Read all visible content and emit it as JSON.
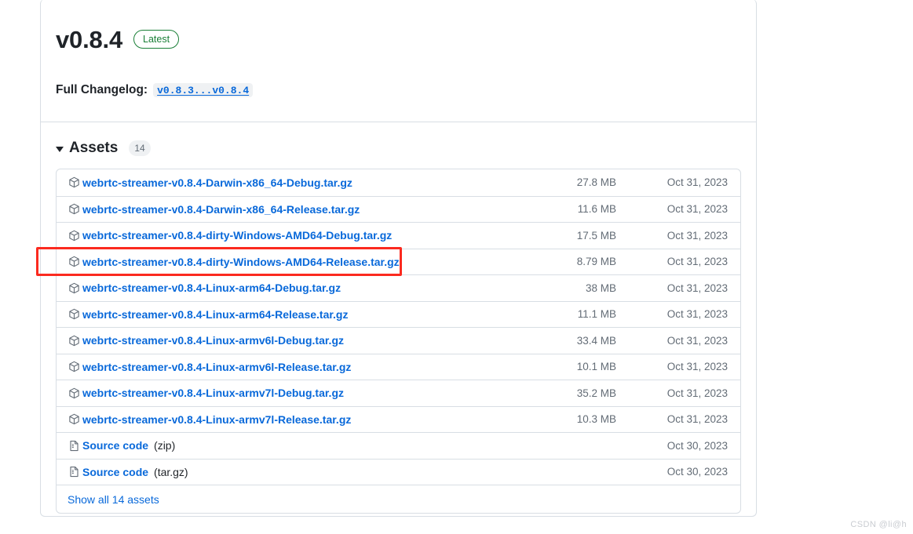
{
  "release": {
    "version_title": "v0.8.4",
    "latest_badge": "Latest",
    "changelog_label": "Full Changelog:",
    "changelog_link": "v0.8.3...v0.8.4"
  },
  "assets": {
    "section_title": "Assets",
    "count": "14",
    "disclosure_icon": "triangle-down-icon",
    "show_all_label": "Show all 14 assets",
    "rows": [
      {
        "icon": "package-icon",
        "name": "webrtc-streamer-v0.8.4-Darwin-x86_64-Debug.tar.gz",
        "suffix": "",
        "size": "27.8 MB",
        "date": "Oct 31, 2023"
      },
      {
        "icon": "package-icon",
        "name": "webrtc-streamer-v0.8.4-Darwin-x86_64-Release.tar.gz",
        "suffix": "",
        "size": "11.6 MB",
        "date": "Oct 31, 2023"
      },
      {
        "icon": "package-icon",
        "name": "webrtc-streamer-v0.8.4-dirty-Windows-AMD64-Debug.tar.gz",
        "suffix": "",
        "size": "17.5 MB",
        "date": "Oct 31, 2023"
      },
      {
        "icon": "package-icon",
        "name": "webrtc-streamer-v0.8.4-dirty-Windows-AMD64-Release.tar.gz",
        "suffix": "",
        "size": "8.79 MB",
        "date": "Oct 31, 2023"
      },
      {
        "icon": "package-icon",
        "name": "webrtc-streamer-v0.8.4-Linux-arm64-Debug.tar.gz",
        "suffix": "",
        "size": "38 MB",
        "date": "Oct 31, 2023"
      },
      {
        "icon": "package-icon",
        "name": "webrtc-streamer-v0.8.4-Linux-arm64-Release.tar.gz",
        "suffix": "",
        "size": "11.1 MB",
        "date": "Oct 31, 2023"
      },
      {
        "icon": "package-icon",
        "name": "webrtc-streamer-v0.8.4-Linux-armv6l-Debug.tar.gz",
        "suffix": "",
        "size": "33.4 MB",
        "date": "Oct 31, 2023"
      },
      {
        "icon": "package-icon",
        "name": "webrtc-streamer-v0.8.4-Linux-armv6l-Release.tar.gz",
        "suffix": "",
        "size": "10.1 MB",
        "date": "Oct 31, 2023"
      },
      {
        "icon": "package-icon",
        "name": "webrtc-streamer-v0.8.4-Linux-armv7l-Debug.tar.gz",
        "suffix": "",
        "size": "35.2 MB",
        "date": "Oct 31, 2023"
      },
      {
        "icon": "package-icon",
        "name": "webrtc-streamer-v0.8.4-Linux-armv7l-Release.tar.gz",
        "suffix": "",
        "size": "10.3 MB",
        "date": "Oct 31, 2023"
      },
      {
        "icon": "file-code-icon",
        "name": "Source code",
        "suffix": "(zip)",
        "size": "",
        "date": "Oct 30, 2023"
      },
      {
        "icon": "file-code-icon",
        "name": "Source code",
        "suffix": "(tar.gz)",
        "size": "",
        "date": "Oct 30, 2023"
      }
    ]
  },
  "annotation": {
    "highlighted_row_index": 3,
    "box_color": "#fb2a1f"
  },
  "watermark": {
    "text": "CSDN @li@h"
  },
  "colors": {
    "link": "#0969da",
    "text": "#1f2328",
    "muted": "#636c76",
    "border": "#d8dee4",
    "badge_green": "#1a7f37",
    "badge_bg": "#eff1f3"
  }
}
